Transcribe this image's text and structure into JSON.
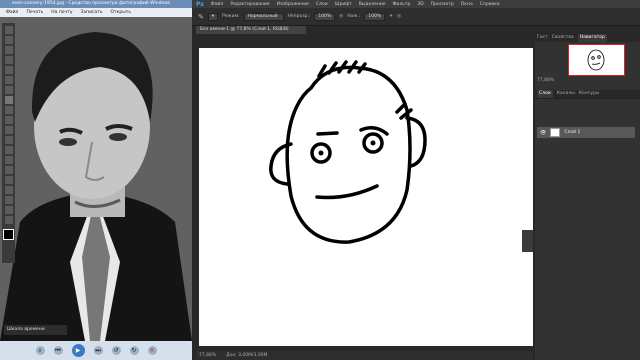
{
  "viewer": {
    "title": "sean-connery-1954.jpg - Средство просмотра фотографий Windows",
    "menu": [
      "Файл",
      "Печать",
      "На почту",
      "Записать",
      "Открыть"
    ],
    "sidebar_label": "Шкала времени",
    "controls": [
      "zoom-icon",
      "prev-icon",
      "play-icon",
      "next-icon",
      "rotate-left-icon",
      "rotate-right-icon",
      "delete-icon"
    ]
  },
  "photoshop": {
    "logo": "Ps",
    "menu": [
      "Файл",
      "Редактирование",
      "Изображение",
      "Слои",
      "Шрифт",
      "Выделение",
      "Фильтр",
      "3D",
      "Просмотр",
      "Окно",
      "Справка"
    ],
    "options": {
      "mode_label": "Режим:",
      "mode_value": "Нормальный",
      "opacity_label": "Непрозр.:",
      "opacity_value": "100%",
      "flow_label": "Наж.:",
      "flow_value": "100%"
    },
    "document_tab": "Без имени-1 @ 77,8% (Слой 1, RGB/8)",
    "status": {
      "zoom": "77,88%",
      "doc": "Док: 3,00M/3,00M"
    },
    "panels": {
      "nav_tabs": [
        "Гист",
        "Свойства",
        "Навигатор"
      ],
      "nav_zoom": "77,88%",
      "layers_tabs": [
        "Слои",
        "Каналы",
        "Контуры"
      ],
      "layer_name": "Слой 1"
    }
  }
}
